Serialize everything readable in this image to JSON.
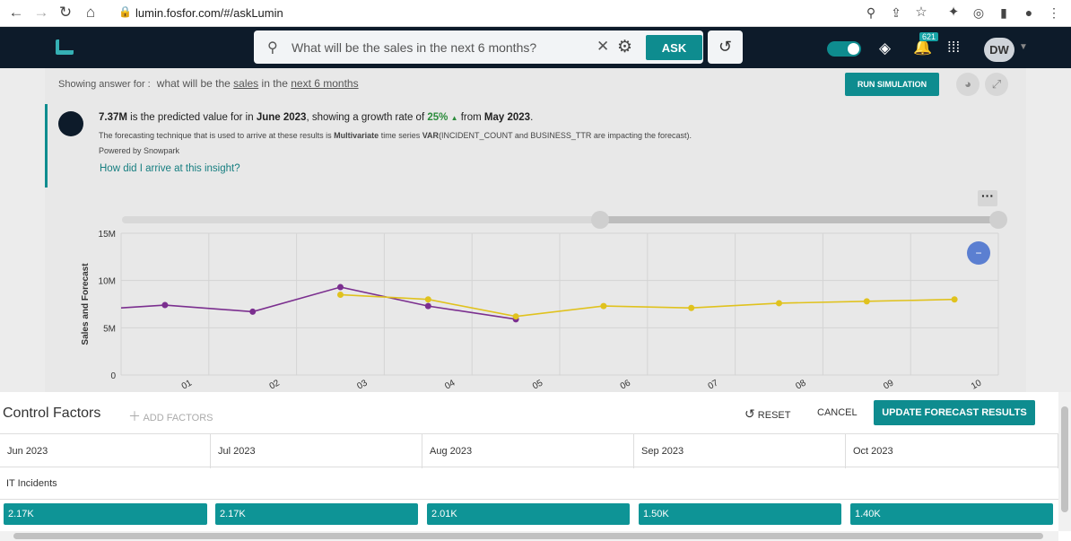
{
  "browser": {
    "url": "lumin.fosfor.com/#/askLumin"
  },
  "header": {
    "search_query": "What will be the sales in the next 6 months?",
    "ask_label": "ASK",
    "notification_count": "621",
    "avatar_initials": "DW"
  },
  "answer": {
    "showing_label": "Showing answer for :",
    "q_part1": "what will be the",
    "q_sales": "sales",
    "q_part2": "in the",
    "q_months": "next 6 months",
    "run_simulation_label": "RUN SIMULATION"
  },
  "insight": {
    "value": "7.37M",
    "text1": "is the predicted value for in",
    "month": "June 2023",
    "text2": ", showing a growth rate of",
    "rate": "25%",
    "text3": "from",
    "from_month": "May 2023",
    "text4": ".",
    "sub1": "The forecasting technique that is used to arrive at these results is",
    "sub_mv": "Multivariate",
    "sub2": "time series",
    "sub_var": "VAR",
    "sub3": "(INCIDENT_COUNT and BUSINESS_TTR are impacting the forecast).",
    "powered": "Powered by Snowpark",
    "how_link": "How did I arrive at this insight?"
  },
  "chart_data": {
    "type": "line",
    "ylabel": "Sales and Forecast",
    "ylim": [
      0,
      15
    ],
    "yticks": [
      "0",
      "5M",
      "10M",
      "15M"
    ],
    "x_tick_labels": [
      "01",
      "02",
      "03",
      "04",
      "05",
      "06",
      "07",
      "08",
      "09",
      "10"
    ],
    "series": [
      {
        "color": "#7b2f8f",
        "x": [
          0,
          1,
          2,
          3,
          4,
          4.5
        ],
        "values": [
          7.4,
          6.7,
          9.3,
          7.3,
          5.9,
          null
        ]
      },
      {
        "color": "#e0c21e",
        "x": [
          2,
          3,
          4,
          5,
          6,
          7,
          8,
          9
        ],
        "values": [
          8.5,
          8.0,
          6.2,
          7.3,
          7.1,
          7.6,
          7.8,
          8.0
        ]
      }
    ]
  },
  "control": {
    "title": "Control Factors",
    "add_factors_label": "ADD FACTORS",
    "reset_label": "RESET",
    "cancel_label": "CANCEL",
    "update_label": "UPDATE FORECAST RESULTS",
    "months": [
      "Jun 2023",
      "Jul 2023",
      "Aug 2023",
      "Sep 2023",
      "Oct 2023"
    ],
    "factor_name": "IT Incidents",
    "factor_values": [
      "2.17K",
      "2.17K",
      "2.01K",
      "1.50K",
      "1.40K"
    ]
  }
}
